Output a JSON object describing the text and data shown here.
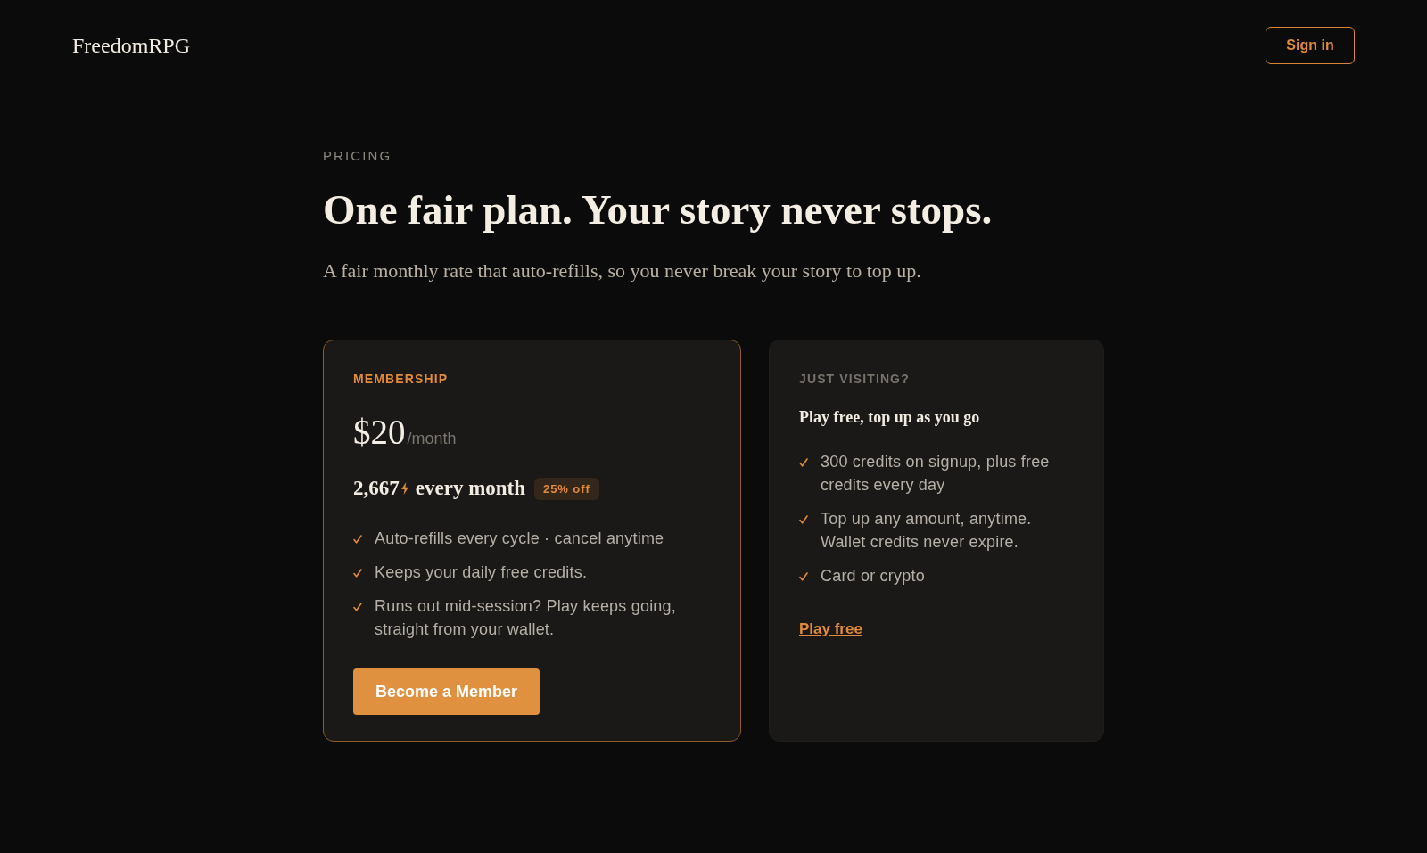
{
  "header": {
    "logo": "FreedomRPG",
    "sign_in": "Sign in"
  },
  "hero": {
    "eyebrow": "PRICING",
    "title": "One fair plan. Your story never stops.",
    "subtitle": "A fair monthly rate that auto-refills, so you never break your story to top up."
  },
  "plans": [
    {
      "label": "MEMBERSHIP",
      "featured": true,
      "price": "$20",
      "period": "/month",
      "credits": "2,667",
      "credits_period": "every month",
      "badge": "25% off",
      "features": [
        "Auto-refills every cycle · cancel anytime",
        "Keeps your daily free credits.",
        "Runs out mid-session? Play keeps going, straight from your wallet."
      ],
      "cta": {
        "kind": "button",
        "label": "Become a Member"
      }
    },
    {
      "label": "JUST VISITING?",
      "featured": false,
      "heading": "Play free, top up as you go",
      "features": [
        "300 credits on signup, plus free credits every day",
        "Top up any amount, anytime. Wallet credits never expire.",
        "Card or crypto"
      ],
      "cta": {
        "kind": "link",
        "label": "Play free"
      }
    }
  ]
}
